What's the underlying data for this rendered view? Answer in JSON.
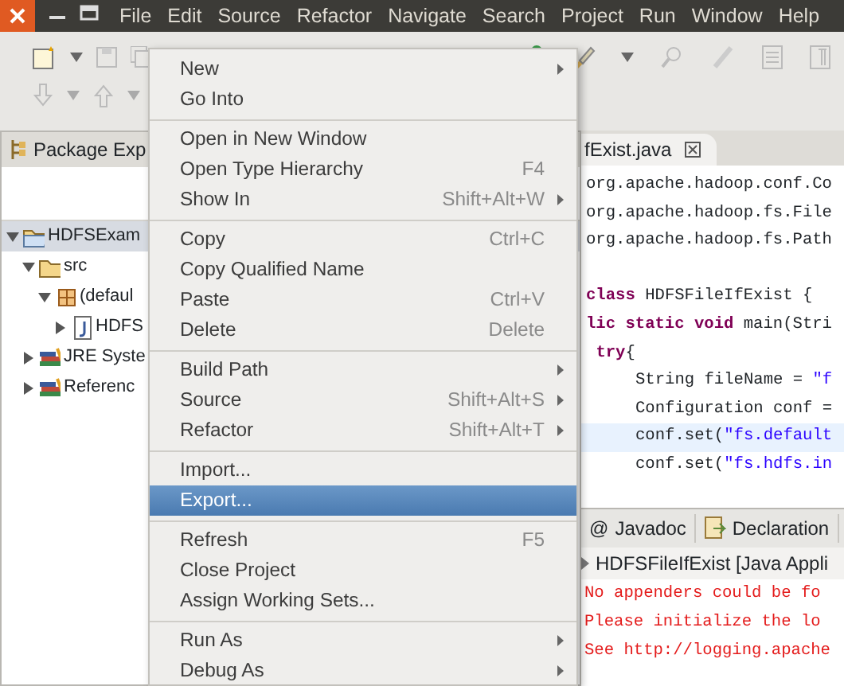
{
  "menu_bar": [
    "File",
    "Edit",
    "Source",
    "Refactor",
    "Navigate",
    "Search",
    "Project",
    "Run",
    "Window",
    "Help"
  ],
  "package_explorer": {
    "title": "Package Exp",
    "tree": [
      {
        "label": "HDFSExam",
        "kind": "project",
        "expanded": true,
        "selected": true,
        "children": [
          {
            "label": "src",
            "kind": "folder",
            "expanded": true,
            "selected": false,
            "children": [
              {
                "label": "(defaul",
                "kind": "package",
                "expanded": true,
                "selected": false,
                "children": [
                  {
                    "label": "HDFS",
                    "kind": "java",
                    "expanded": false,
                    "selected": false
                  }
                ]
              }
            ]
          },
          {
            "label": "JRE Syste",
            "kind": "library",
            "expanded": false,
            "selected": false
          },
          {
            "label": "Referenc",
            "kind": "library",
            "expanded": false,
            "selected": false
          }
        ]
      }
    ]
  },
  "editor": {
    "tab": "fExist.java",
    "lines": [
      {
        "highlighted": false,
        "segments": [
          {
            "kind": "plain",
            "text": "org.apache.hadoop.conf.Co"
          }
        ]
      },
      {
        "highlighted": false,
        "segments": [
          {
            "kind": "plain",
            "text": "org.apache.hadoop.fs.File"
          }
        ]
      },
      {
        "highlighted": false,
        "segments": [
          {
            "kind": "plain",
            "text": "org.apache.hadoop.fs.Path"
          }
        ]
      },
      {
        "highlighted": false
      },
      {
        "highlighted": false,
        "segments": [
          {
            "kind": "keyword",
            "text": "class"
          },
          {
            "kind": "plain",
            "text": " HDFSFileIfExist {"
          }
        ]
      },
      {
        "highlighted": false,
        "segments": [
          {
            "kind": "keyword",
            "text": "lic static void"
          },
          {
            "kind": "plain",
            "text": " main(Stri"
          }
        ],
        "children": [
          {
            "highlighted": false,
            "segments": [
              {
                "kind": "keyword",
                "text": "try"
              },
              {
                "kind": "plain",
                "text": "{"
              }
            ],
            "children": [
              {
                "highlighted": false,
                "segments": [
                  {
                    "kind": "plain",
                    "text": "String fileName = "
                  },
                  {
                    "kind": "string",
                    "text": "\"f"
                  }
                ]
              },
              {
                "highlighted": false,
                "segments": [
                  {
                    "kind": "plain",
                    "text": "Configuration conf ="
                  }
                ]
              },
              {
                "highlighted": true,
                "segments": [
                  {
                    "kind": "plain",
                    "text": "conf.set("
                  },
                  {
                    "kind": "string",
                    "text": "\"fs.default"
                  }
                ]
              },
              {
                "highlighted": false,
                "segments": [
                  {
                    "kind": "plain",
                    "text": "conf.set("
                  },
                  {
                    "kind": "string",
                    "text": "\"fs.hdfs.in"
                  }
                ]
              }
            ]
          }
        ]
      }
    ]
  },
  "bottom_panel": {
    "tabs": [
      {
        "label": "Javadoc",
        "glyph": "@"
      },
      {
        "label": "Declaration"
      }
    ],
    "console_title": "HDFSFileIfExist [Java Appli",
    "output": [
      "No appenders could be fo",
      "Please initialize the lo",
      "See http://logging.apache"
    ]
  },
  "context_menu": {
    "groups": [
      [
        {
          "label": "New",
          "submenu": true,
          "selected": false
        },
        {
          "label": "Go Into",
          "submenu": false,
          "selected": false
        }
      ],
      [
        {
          "label": "Open in New Window",
          "submenu": false,
          "selected": false
        },
        {
          "label": "Open Type Hierarchy",
          "shortcut": "F4",
          "submenu": false,
          "selected": false
        },
        {
          "label": "Show In",
          "shortcut": "Shift+Alt+W",
          "submenu": true,
          "selected": false
        }
      ],
      [
        {
          "label": "Copy",
          "shortcut": "Ctrl+C",
          "submenu": false,
          "selected": false
        },
        {
          "label": "Copy Qualified Name",
          "submenu": false,
          "selected": false
        },
        {
          "label": "Paste",
          "shortcut": "Ctrl+V",
          "submenu": false,
          "selected": false
        },
        {
          "label": "Delete",
          "shortcut": "Delete",
          "submenu": false,
          "selected": false
        }
      ],
      [
        {
          "label": "Build Path",
          "submenu": true,
          "selected": false
        },
        {
          "label": "Source",
          "shortcut": "Shift+Alt+S",
          "submenu": true,
          "selected": false
        },
        {
          "label": "Refactor",
          "shortcut": "Shift+Alt+T",
          "submenu": true,
          "selected": false
        }
      ],
      [
        {
          "label": "Import...",
          "submenu": false,
          "selected": false
        },
        {
          "label": "Export...",
          "submenu": false,
          "selected": true
        }
      ],
      [
        {
          "label": "Refresh",
          "shortcut": "F5",
          "submenu": false,
          "selected": false
        },
        {
          "label": "Close Project",
          "submenu": false,
          "selected": false
        },
        {
          "label": "Assign Working Sets...",
          "submenu": false,
          "selected": false
        }
      ],
      [
        {
          "label": "Run As",
          "submenu": true,
          "selected": false
        },
        {
          "label": "Debug As",
          "submenu": true,
          "selected": false
        }
      ]
    ]
  }
}
